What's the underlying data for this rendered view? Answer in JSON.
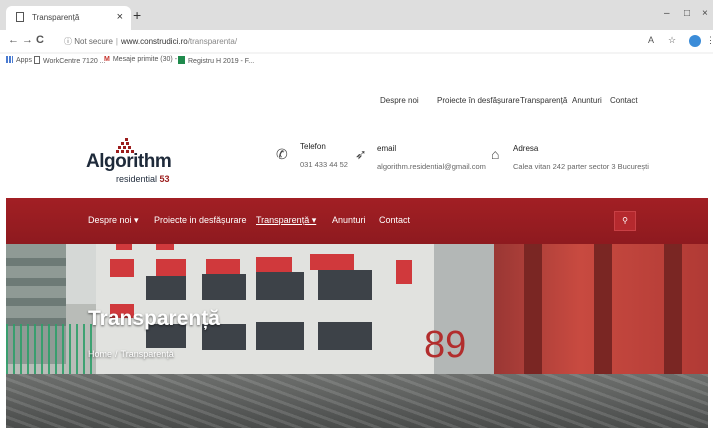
{
  "browser": {
    "tab_title": "Transparență",
    "tab_close": "×",
    "new_tab": "+",
    "window_controls": [
      "–",
      "□",
      "×"
    ],
    "nav_icons": [
      "←",
      "→",
      "C"
    ],
    "security_label": "Not secure",
    "url_host": "www.construdici.ro",
    "url_path": "/transparenta/",
    "extension_icons": [
      "A",
      "☆"
    ],
    "profile_initial": "",
    "menu_icon": "⋮",
    "bookmarks": [
      {
        "label": "Apps",
        "icon": "apps-grid-icon"
      },
      {
        "label": "WorkCentre 7120 ...",
        "icon": "page-icon"
      },
      {
        "label": "Mesaje primite (30) - ...",
        "icon": "gmail-icon"
      },
      {
        "label": "Registru H 2019 - F...",
        "icon": "sheets-icon"
      }
    ]
  },
  "top_links": [
    "Despre noi",
    "Proiecte în desfășurare",
    "Transparență",
    "Anunturi",
    "Contact"
  ],
  "logo": {
    "name": "Algorithm",
    "sub_text": "residential",
    "sub_number": "53"
  },
  "contacts": [
    {
      "icon": "phone-icon",
      "glyph": "✆",
      "label": "Telefon",
      "value": "031 433 44 52"
    },
    {
      "icon": "paper-plane-icon",
      "glyph": "➶",
      "label": "email",
      "value": "algorithm.residential@gmail.com"
    },
    {
      "icon": "home-icon",
      "glyph": "⌂",
      "label": "Adresa",
      "value": "Calea vitan 242 parter sector 3 București"
    }
  ],
  "main_nav": [
    {
      "label": "Despre noi ▾",
      "active": false
    },
    {
      "label": "Proiecte in desfășurare",
      "active": false
    },
    {
      "label": "Transparență ▾",
      "active": true
    },
    {
      "label": "Anunturi",
      "active": false
    },
    {
      "label": "Contact",
      "active": false
    }
  ],
  "search_icon_glyph": "⚲",
  "hero": {
    "title": "Transparență",
    "breadcrumb_home": "Home",
    "breadcrumb_sep": "/",
    "breadcrumb_current": "Transparență",
    "building_number": "89"
  },
  "colors": {
    "brand_red": "#9b1c1c",
    "nav_red": "#a21f24",
    "logo_navy": "#1e2a3a"
  }
}
